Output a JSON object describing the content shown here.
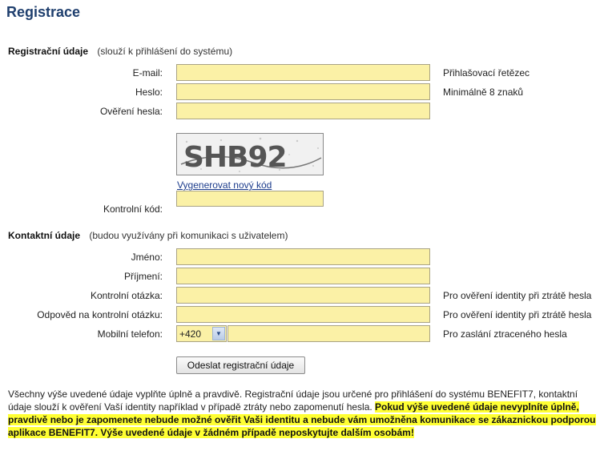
{
  "page": {
    "title": "Registrace"
  },
  "registration": {
    "heading": "Registrační údaje",
    "note": "(slouží k přihlášení do systému)",
    "email": {
      "label": "E-mail:",
      "hint": "Přihlašovací řetězec",
      "value": ""
    },
    "password": {
      "label": "Heslo:",
      "hint": "Minimálně 8 znaků",
      "value": ""
    },
    "password_confirm": {
      "label": "Ověření hesla:",
      "value": ""
    },
    "captcha": {
      "image_text": "SHB92",
      "regenerate_link": "Vygenerovat nový kód",
      "label": "Kontrolní kód:",
      "value": ""
    }
  },
  "contact": {
    "heading": "Kontaktní údaje",
    "note": "(budou využívány při komunikaci s uživatelem)",
    "first_name": {
      "label": "Jméno:",
      "value": ""
    },
    "last_name": {
      "label": "Příjmení:",
      "value": ""
    },
    "security_question": {
      "label": "Kontrolní otázka:",
      "hint": "Pro ověření identity při ztrátě hesla",
      "value": ""
    },
    "security_answer": {
      "label": "Odpověd na kontrolní otázku:",
      "hint": "Pro ověření identity při ztrátě hesla",
      "value": ""
    },
    "mobile": {
      "label": "Mobilní telefon:",
      "prefix": "+420",
      "hint": "Pro zaslání ztraceného hesla",
      "value": ""
    }
  },
  "actions": {
    "submit_label": "Odeslat registrační údaje"
  },
  "footer": {
    "plain": "Všechny výše uvedené údaje vyplňte úplně a pravdivě. Registrační údaje jsou určené pro přihlášení do systému BENEFIT7, kontaktní údaje slouží k ověření Vaší identity například v případě ztráty nebo zapomenutí hesla. ",
    "highlight": "Pokud výše uvedené údaje nevyplníte úplně, pravdivě nebo je zapomenete nebude možné ověřit Vaši identitu a nebude vám umožněna komunikace se zákaznickou podporou aplikace BENEFIT7. Výše uvedené údaje v žádném případě neposkytujte dalším osobám!"
  },
  "colors": {
    "field_bg": "#fbf1a6",
    "title": "#1f3f6e",
    "highlight": "#ffff33",
    "link": "#1c3c8c"
  },
  "icons": {
    "select_arrow": "chevron-down-icon"
  }
}
